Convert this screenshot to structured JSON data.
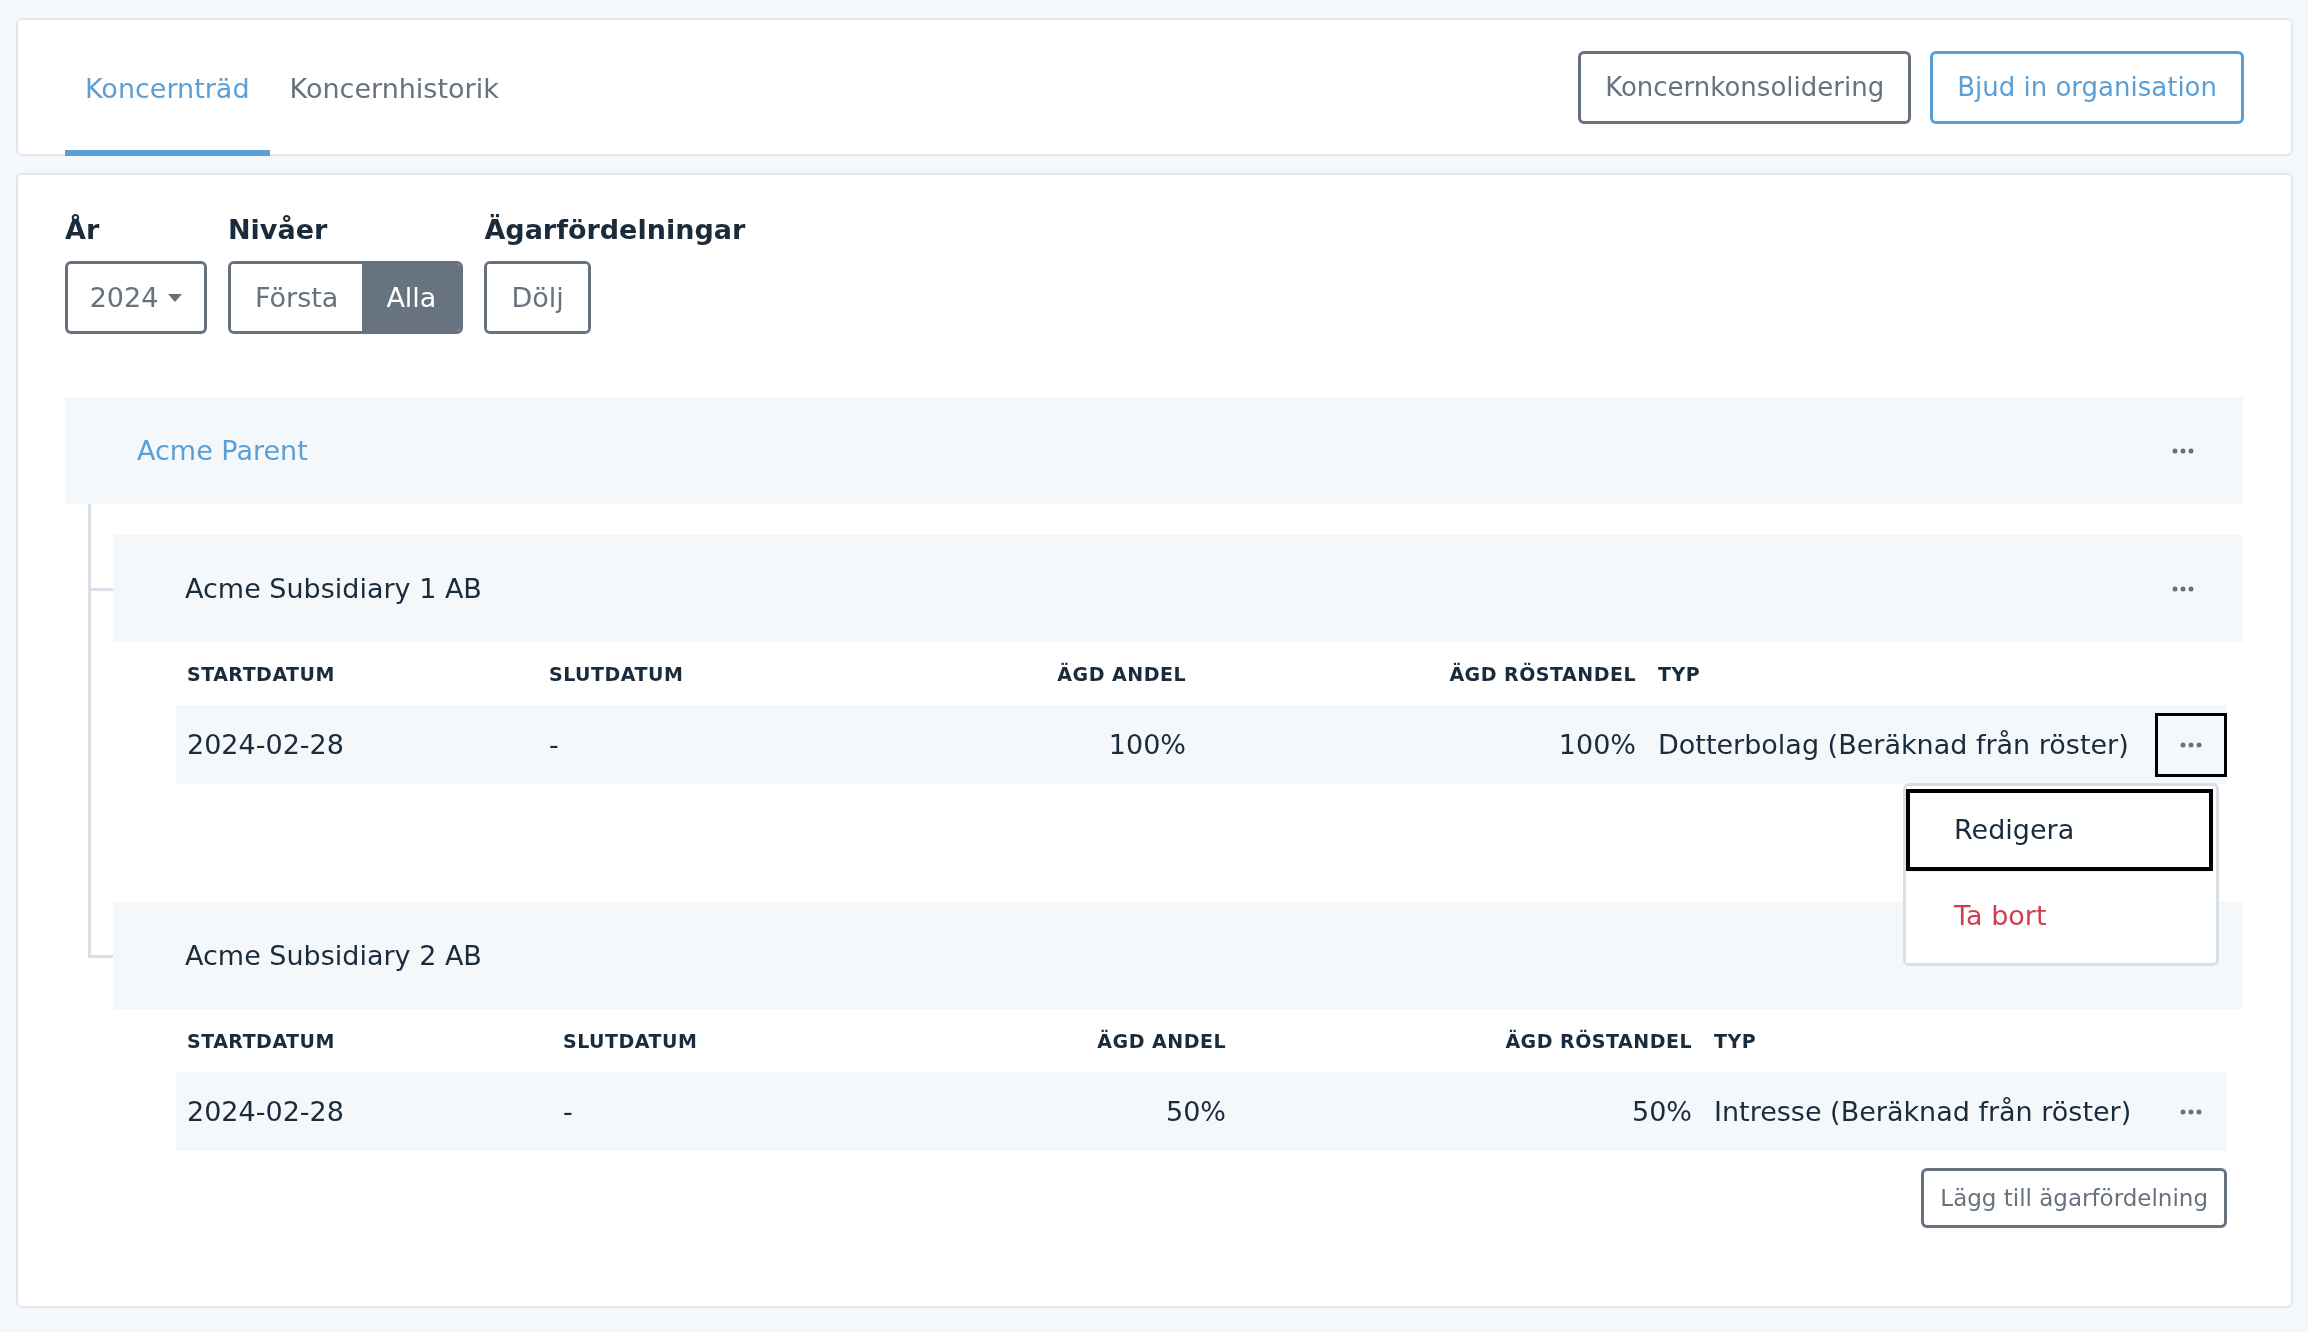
{
  "tabs": [
    {
      "label": "Koncernträd",
      "selected": true
    },
    {
      "label": "Koncernhistorik",
      "selected": false
    }
  ],
  "header_buttons": [
    {
      "label": "Koncernkonsolidering",
      "kind": "secondary"
    },
    {
      "label": "Bjud in organisation",
      "kind": "primary"
    }
  ],
  "filters": [
    {
      "label": "År",
      "kind": "dropdown",
      "value": "2024"
    },
    {
      "label": "Nivåer",
      "kind": "toggle",
      "options": [
        {
          "label": "Första",
          "selected": false
        },
        {
          "label": "Alla",
          "selected": true
        }
      ]
    },
    {
      "label": "Ägarfördelningar",
      "kind": "toggle",
      "options": [
        {
          "label": "Dölj",
          "selected": false
        }
      ]
    }
  ],
  "tree": {
    "name": "Acme Parent",
    "children": [
      {
        "name": "Acme Subsidiary 1 AB",
        "columns": [
          "STARTDATUM",
          "SLUTDATUM",
          "ÄGD ANDEL",
          "ÄGD RÖSTANDEL",
          "TYP"
        ],
        "rows": [
          {
            "cells": [
              "2024-02-28",
              "-",
              "100%",
              "100%",
              "Dotterbolag (Beräknad från röster)"
            ],
            "menu_open": true,
            "menu": [
              {
                "label": "Redigera",
                "kind": "default",
                "focused": true
              },
              {
                "label": "Ta bort",
                "kind": "danger",
                "focused": false
              }
            ]
          }
        ]
      },
      {
        "name": "Acme Subsidiary 2 AB",
        "columns": [
          "STARTDATUM",
          "SLUTDATUM",
          "ÄGD ANDEL",
          "ÄGD RÖSTANDEL",
          "TYP"
        ],
        "rows": [
          {
            "cells": [
              "2024-02-28",
              "-",
              "50%",
              "50%",
              "Intresse (Beräknad från röster)"
            ],
            "menu_open": false
          }
        ],
        "add_button": "Lägg till ägarfördelning"
      }
    ]
  }
}
